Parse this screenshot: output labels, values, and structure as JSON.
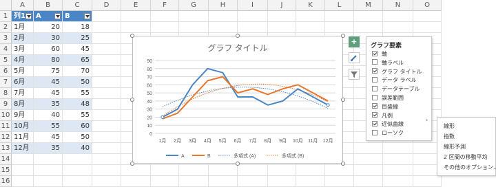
{
  "columns": [
    "A",
    "B",
    "C",
    "D",
    "E",
    "F",
    "G",
    "H",
    "I",
    "J",
    "K",
    "L",
    "M",
    "N",
    "O"
  ],
  "rows": [
    "1",
    "2",
    "3",
    "4",
    "5",
    "6",
    "7",
    "8",
    "9",
    "10",
    "11",
    "12",
    "13",
    "14",
    "15",
    "16"
  ],
  "table": {
    "headers": [
      "列1",
      "A",
      "B"
    ],
    "data": [
      [
        "1月",
        "20",
        "18"
      ],
      [
        "2月",
        "30",
        "25"
      ],
      [
        "3月",
        "60",
        "45"
      ],
      [
        "4月",
        "80",
        "65"
      ],
      [
        "5月",
        "75",
        "70"
      ],
      [
        "6月",
        "45",
        "50"
      ],
      [
        "7月",
        "45",
        "55"
      ],
      [
        "8月",
        "35",
        "48"
      ],
      [
        "9月",
        "40",
        "55"
      ],
      [
        "10月",
        "55",
        "60"
      ],
      [
        "11月",
        "45",
        "50"
      ],
      [
        "12月",
        "35",
        "40"
      ]
    ]
  },
  "chart_data": {
    "type": "line",
    "title": "グラフ タイトル",
    "categories": [
      "1月",
      "2月",
      "3月",
      "4月",
      "5月",
      "6月",
      "7月",
      "8月",
      "9月",
      "10月",
      "11月",
      "12月"
    ],
    "series": [
      {
        "name": "A",
        "values": [
          20,
          30,
          60,
          80,
          75,
          45,
          45,
          35,
          40,
          55,
          45,
          35
        ],
        "color": "#4a86c5"
      },
      {
        "name": "B",
        "values": [
          18,
          25,
          45,
          65,
          70,
          50,
          55,
          48,
          55,
          60,
          50,
          40
        ],
        "color": "#e8762b"
      }
    ],
    "trendlines": [
      {
        "name": "多項式 (A)",
        "color": "#4a86c5"
      },
      {
        "name": "多項式 (B)",
        "color": "#e8762b"
      }
    ],
    "ylim": [
      0,
      90
    ],
    "yticks": [
      "0",
      "10",
      "20",
      "30",
      "40",
      "50",
      "60",
      "70",
      "80",
      "90"
    ],
    "grid": true,
    "legend": "bottom"
  },
  "chart_elements_panel": {
    "title": "グラフ要素",
    "items": [
      {
        "label": "軸",
        "checked": true
      },
      {
        "label": "軸ラベル",
        "checked": false
      },
      {
        "label": "グラフ タイトル",
        "checked": true
      },
      {
        "label": "データ ラベル",
        "checked": false
      },
      {
        "label": "データテーブル",
        "checked": false
      },
      {
        "label": "誤差範囲",
        "checked": false
      },
      {
        "label": "目盛線",
        "checked": true
      },
      {
        "label": "凡例",
        "checked": true
      },
      {
        "label": "近似曲線",
        "checked": true
      },
      {
        "label": "ローソク",
        "checked": false
      }
    ]
  },
  "trendline_submenu": {
    "items": [
      "線形",
      "指数",
      "線形予測",
      "2 区間の移動平均",
      "その他のオプション..."
    ]
  }
}
